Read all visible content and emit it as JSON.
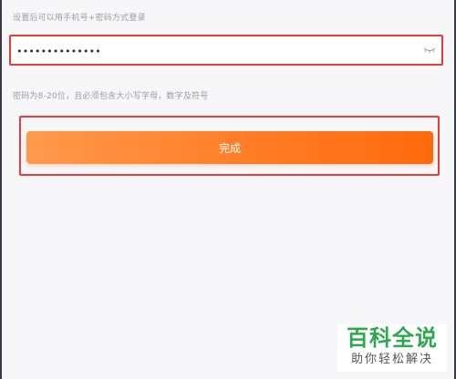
{
  "header": {
    "subtitle": "设置后可以用手机号+密码方式登录"
  },
  "password": {
    "value": "••••••••••••••",
    "eye_icon": "eye-closed-icon"
  },
  "hint": {
    "text": "密码为8-20位，且必须包含大小写字母，数字及符号"
  },
  "actions": {
    "submit_label": "完成"
  },
  "watermark": {
    "title": "百科全说",
    "subtitle": "助你轻松解决"
  },
  "colors": {
    "highlight": "#e43b3b",
    "button_start": "#ff9a4c",
    "button_end": "#ff6a0c",
    "watermark_green": "#2ea84e"
  }
}
